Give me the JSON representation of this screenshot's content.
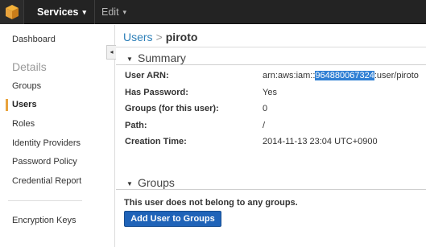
{
  "topbar": {
    "logo_icon": "aws-cube-icon",
    "services_label": "Services",
    "edit_label": "Edit",
    "caret_glyph": "▾",
    "brand_color": "#e8a33d"
  },
  "sidebar": {
    "collapse_glyph": "◂",
    "dashboard": "Dashboard",
    "details_heading": "Details",
    "items": [
      {
        "label": "Groups"
      },
      {
        "label": "Users"
      },
      {
        "label": "Roles"
      },
      {
        "label": "Identity Providers"
      },
      {
        "label": "Password Policy"
      },
      {
        "label": "Credential Report"
      }
    ],
    "active_item": "Users",
    "encryption_keys": "Encryption Keys"
  },
  "main": {
    "breadcrumb": {
      "link": "Users",
      "separator": ">",
      "current": "piroto"
    },
    "summary": {
      "title": "Summary",
      "collapse_glyph": "▼",
      "rows": [
        {
          "label": "User ARN:",
          "value_prefix": "arn:aws:iam::",
          "value_highlight": "964880067324",
          "value_suffix": ":user/piroto"
        },
        {
          "label": "Has Password:",
          "value": "Yes"
        },
        {
          "label": "Groups (for this user):",
          "value": "0"
        },
        {
          "label": "Path:",
          "value": "/"
        },
        {
          "label": "Creation Time:",
          "value": "2014-11-13 23:04 UTC+0900"
        }
      ]
    },
    "groups": {
      "title": "Groups",
      "collapse_glyph": "▼",
      "note": "This user does not belong to any groups.",
      "add_button": "Add User to Groups"
    }
  }
}
